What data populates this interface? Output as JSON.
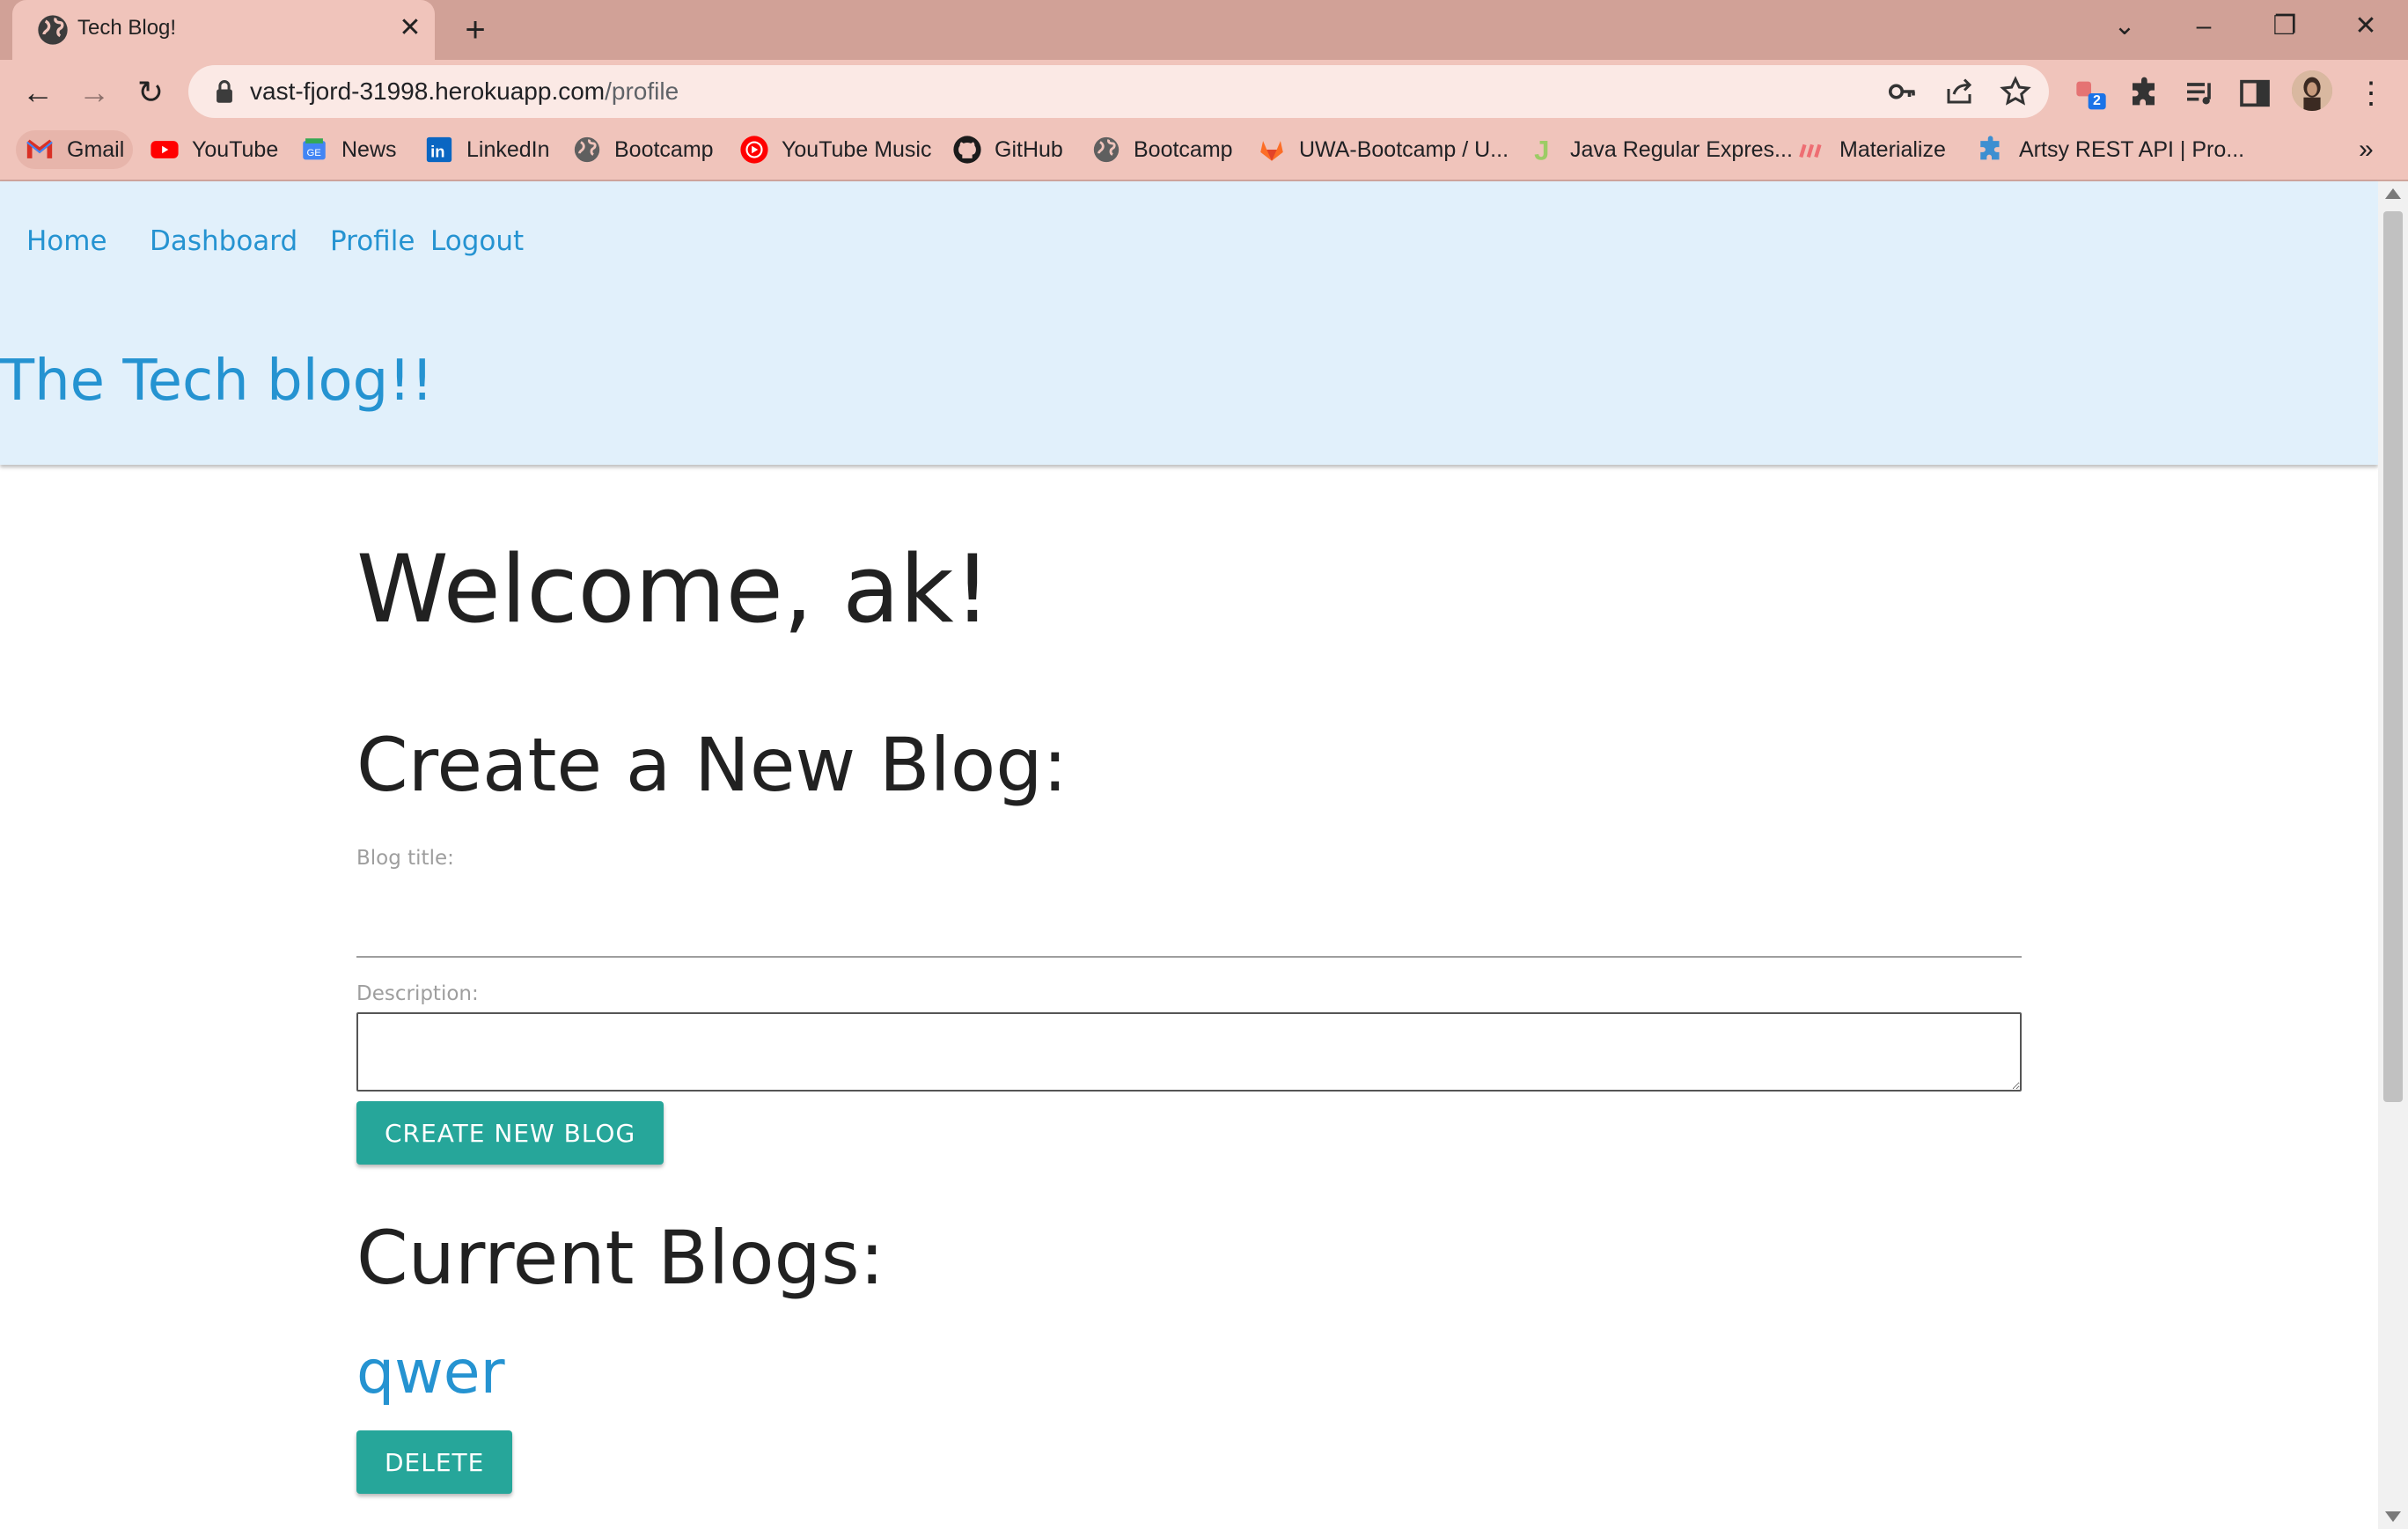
{
  "browser": {
    "tab_title": "Tech Blog!",
    "url_host": "vast-fjord-31998.herokuapp.com",
    "url_path": "/profile",
    "extension_badge": "2",
    "bookmarks": [
      {
        "label": "Gmail",
        "icon": "gmail-icon"
      },
      {
        "label": "YouTube",
        "icon": "youtube-icon"
      },
      {
        "label": "News",
        "icon": "google-news-icon"
      },
      {
        "label": "LinkedIn",
        "icon": "linkedin-icon"
      },
      {
        "label": "Bootcamp",
        "icon": "globe-icon"
      },
      {
        "label": "YouTube Music",
        "icon": "youtube-music-icon"
      },
      {
        "label": "GitHub",
        "icon": "github-icon"
      },
      {
        "label": "Bootcamp",
        "icon": "globe-icon"
      },
      {
        "label": "UWA-Bootcamp / U...",
        "icon": "gitlab-icon"
      },
      {
        "label": "Java Regular Expres...",
        "icon": "j-icon"
      },
      {
        "label": "Materialize",
        "icon": "materialize-icon"
      },
      {
        "label": "Artsy REST API | Pro...",
        "icon": "puzzle-icon"
      }
    ]
  },
  "nav": {
    "home": "Home",
    "dashboard": "Dashboard",
    "profile": "Profile",
    "logout": "Logout"
  },
  "site_title": "The Tech blog!!",
  "main": {
    "welcome": "Welcome, ak!",
    "create_heading": "Create a New Blog:",
    "title_label": "Blog title:",
    "title_value": "",
    "description_label": "Description:",
    "description_value": "",
    "create_button": "CREATE NEW BLOG",
    "current_heading": "Current Blogs:",
    "blogs": [
      {
        "title": "qwer",
        "delete_label": "DELETE"
      }
    ]
  },
  "colors": {
    "accent_link": "#2593d1",
    "button": "#26a69a",
    "header_bg": "#e1f0fb",
    "tabstrip_bg": "#d1a197",
    "toolbar_bg": "#f0c4bb"
  }
}
